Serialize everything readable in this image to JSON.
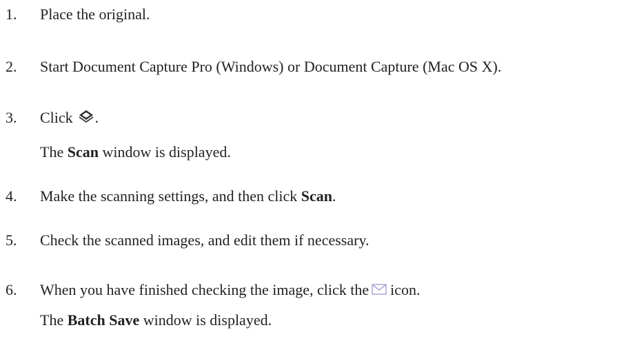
{
  "steps": [
    {
      "num": "1.",
      "text": "Place the original."
    },
    {
      "num": "2.",
      "text": "Start Document Capture Pro (Windows) or Document Capture (Mac OS X)."
    },
    {
      "num": "3.",
      "pre": "Click",
      "post": ".",
      "icon": "scanner-icon",
      "result": {
        "pre": "The ",
        "bold": "Scan",
        "post": " window is displayed."
      }
    },
    {
      "num": "4.",
      "pre": "Make the scanning settings, and then click ",
      "bold": "Scan",
      "post": "."
    },
    {
      "num": "5.",
      "text": "Check the scanned images, and edit them if necessary."
    },
    {
      "num": "6.",
      "pre": "When you have finished checking the image, click the",
      "post": "icon.",
      "icon": "mail-icon",
      "result": {
        "pre": "The ",
        "bold": "Batch Save",
        "post": " window is displayed."
      }
    }
  ],
  "colors": {
    "text": "#231f20",
    "icon_dark": "#2b2b2b",
    "icon_mail": "#a9a6d6"
  }
}
